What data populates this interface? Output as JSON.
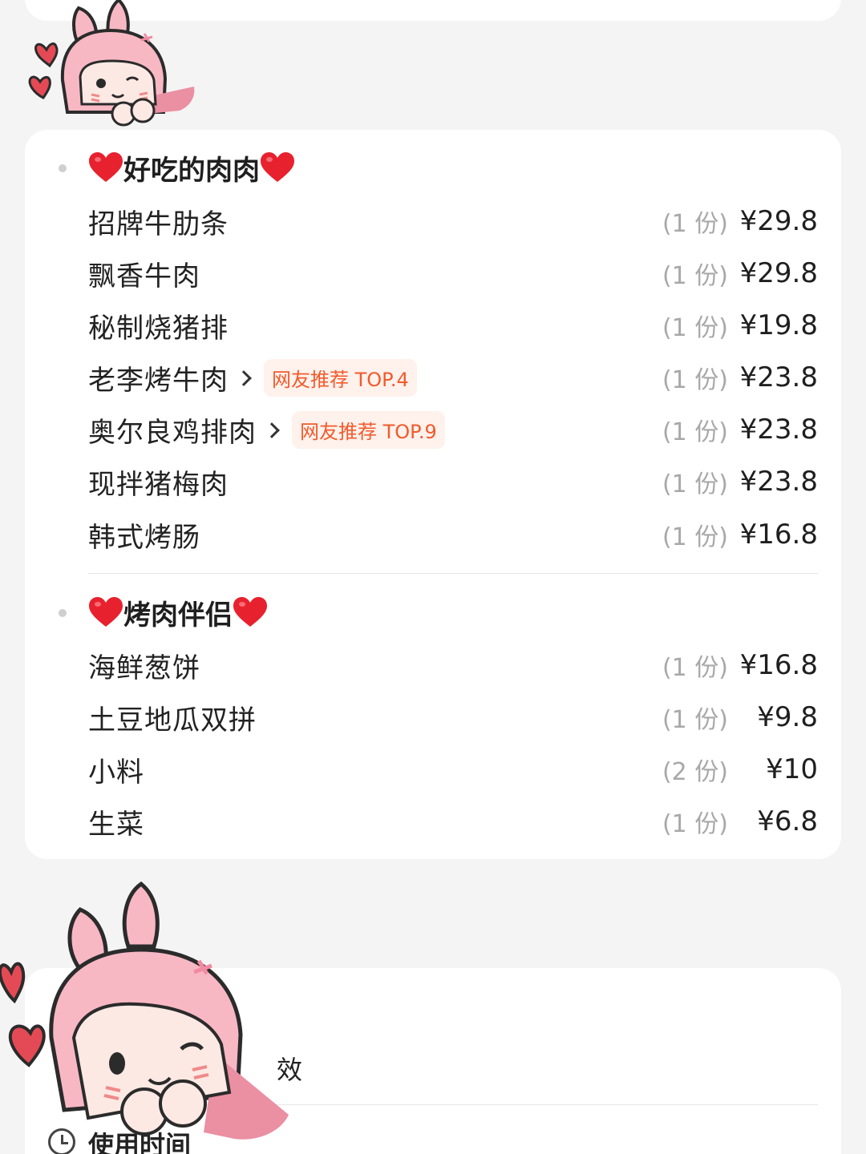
{
  "menu_card": {
    "groups": [
      {
        "title": "好吃的肉肉",
        "items": [
          {
            "name": "招牌牛肋条",
            "qty": "(1 份)",
            "price": "¥29.8"
          },
          {
            "name": "飘香牛肉",
            "qty": "(1 份)",
            "price": "¥29.8"
          },
          {
            "name": "秘制烧猪排",
            "qty": "(1 份)",
            "price": "¥19.8"
          },
          {
            "name": "老李烤牛肉",
            "qty": "(1 份)",
            "price": "¥23.8",
            "badge": "网友推荐 TOP.4"
          },
          {
            "name": "奥尔良鸡排肉",
            "qty": "(1 份)",
            "price": "¥23.8",
            "badge": "网友推荐 TOP.9"
          },
          {
            "name": "现拌猪梅肉",
            "qty": "(1 份)",
            "price": "¥23.8"
          },
          {
            "name": "韩式烤肠",
            "qty": "(1 份)",
            "price": "¥16.8"
          }
        ]
      },
      {
        "title": "烤肉伴侣",
        "items": [
          {
            "name": "海鲜葱饼",
            "qty": "(1 份)",
            "price": "¥16.8"
          },
          {
            "name": "土豆地瓜双拼",
            "qty": "(1 份)",
            "price": "¥9.8"
          },
          {
            "name": "小料",
            "qty": "(2 份)",
            "price": "¥10"
          },
          {
            "name": "生菜",
            "qty": "(1 份)",
            "price": "¥6.8"
          }
        ]
      }
    ]
  },
  "info_card": {
    "partial_text": "效",
    "usage_time_label": "使用时间"
  },
  "colors": {
    "background": "#f4f4f4",
    "card": "#ffffff",
    "badge_text": "#f15a2b",
    "badge_bg": "#fff1ec",
    "heart": "#e8212e",
    "sticker_pink": "#f7b8c4"
  },
  "icons": {
    "heart": "red-heart-emoji",
    "chevron": "chevron-right-icon",
    "clock": "clock-icon",
    "sticker": "pink-bunny-girl-sticker"
  }
}
